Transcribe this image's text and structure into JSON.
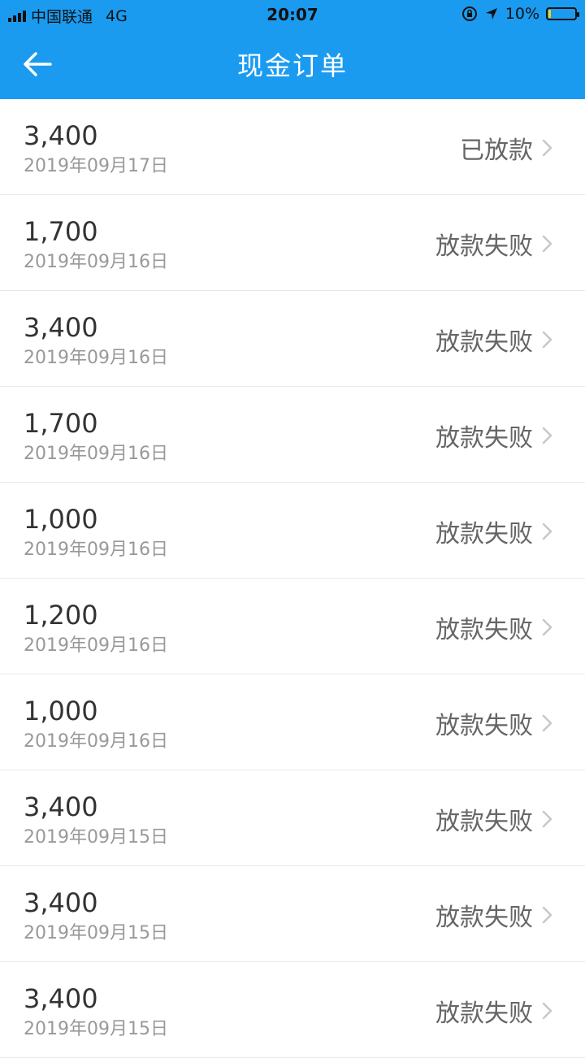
{
  "status_bar": {
    "carrier": "中国联通",
    "network": "4G",
    "time": "20:07",
    "battery": "10%",
    "battery_level": 0.1
  },
  "header": {
    "title": "现金订单",
    "back_icon": "arrow-left-icon"
  },
  "orders": [
    {
      "amount": "3,400",
      "date": "2019年09月17日",
      "status": "已放款"
    },
    {
      "amount": "1,700",
      "date": "2019年09月16日",
      "status": "放款失败"
    },
    {
      "amount": "3,400",
      "date": "2019年09月16日",
      "status": "放款失败"
    },
    {
      "amount": "1,700",
      "date": "2019年09月16日",
      "status": "放款失败"
    },
    {
      "amount": "1,000",
      "date": "2019年09月16日",
      "status": "放款失败"
    },
    {
      "amount": "1,200",
      "date": "2019年09月16日",
      "status": "放款失败"
    },
    {
      "amount": "1,000",
      "date": "2019年09月16日",
      "status": "放款失败"
    },
    {
      "amount": "3,400",
      "date": "2019年09月15日",
      "status": "放款失败"
    },
    {
      "amount": "3,400",
      "date": "2019年09月15日",
      "status": "放款失败"
    },
    {
      "amount": "3,400",
      "date": "2019年09月15日",
      "status": "放款失败"
    }
  ],
  "colors": {
    "accent": "#1A9BF0",
    "amount_text": "#333333",
    "date_text": "#999999",
    "status_text": "#666666"
  }
}
